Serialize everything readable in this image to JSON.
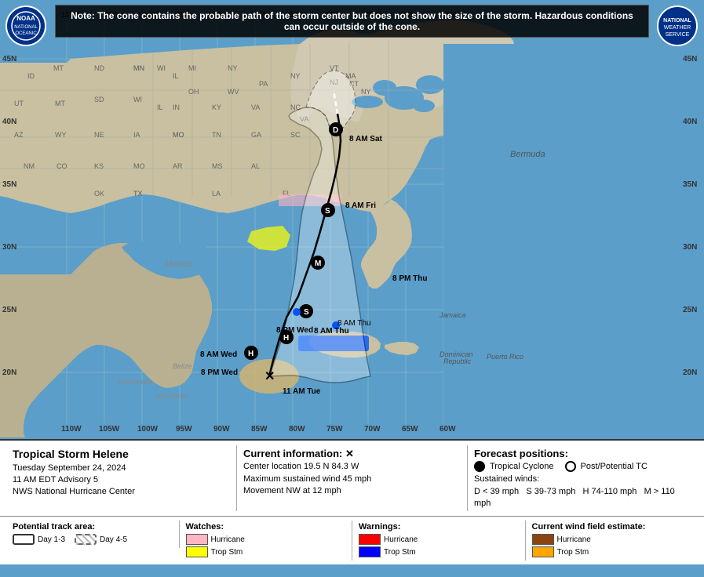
{
  "note": "Note: The cone contains the probable path of the storm center but does not show the size of the storm. Hazardous conditions can occur outside of the cone.",
  "title": "Tropical Storm Helene",
  "date": "Tuesday September 24, 2024",
  "advisory": "11 AM EDT Advisory 5",
  "agency": "NWS National Hurricane Center",
  "current_info_label": "Current information: ✕",
  "center_location": "Center location 19.5 N 84.3 W",
  "max_wind": "Maximum sustained wind 45 mph",
  "movement": "Movement NW at 12 mph",
  "forecast_label": "Forecast positions:",
  "tc_label": "Tropical Cyclone",
  "post_tc_label": "Post/Potential TC",
  "sustained_winds_label": "Sustained winds:",
  "d_label": "D < 39 mph",
  "s_label": "S 39-73 mph",
  "h_label": "H 74-110 mph",
  "m_label": "M > 110 mph",
  "potential_track_label": "Potential track area:",
  "day1_3_label": "Day 1-3",
  "day4_5_label": "Day 4-5",
  "watches_label": "Watches:",
  "hurricane_watch_label": "Hurricane",
  "trop_stm_watch_label": "Trop Stm",
  "warnings_label": "Warnings:",
  "hurricane_warn_label": "Hurricane",
  "trop_stm_warn_label": "Trop Stm",
  "wind_field_label": "Current wind field estimate:",
  "hurricane_wind_label": "Hurricane",
  "trop_stm_wind_label": "Trop Stm",
  "time_labels": {
    "current": "11 AM Tue",
    "thu_am": "8 AM Thu",
    "thu_pm": "8 PM Thu",
    "fri_am": "8 AM Fri",
    "sat_am": "8 AM Sat",
    "wed_am": "8 AM Wed",
    "wed_pm": "8 PM Wed"
  },
  "map": {
    "lat_labels": [
      "45N",
      "40N",
      "35N",
      "30N",
      "25N",
      "20N"
    ],
    "lon_labels": [
      "110W",
      "105W",
      "100W",
      "95W",
      "90W",
      "85W",
      "80W",
      "75W",
      "70W",
      "65W",
      "60W"
    ],
    "bermuda_label": "Bermuda",
    "mexico_label": "Mexico"
  }
}
